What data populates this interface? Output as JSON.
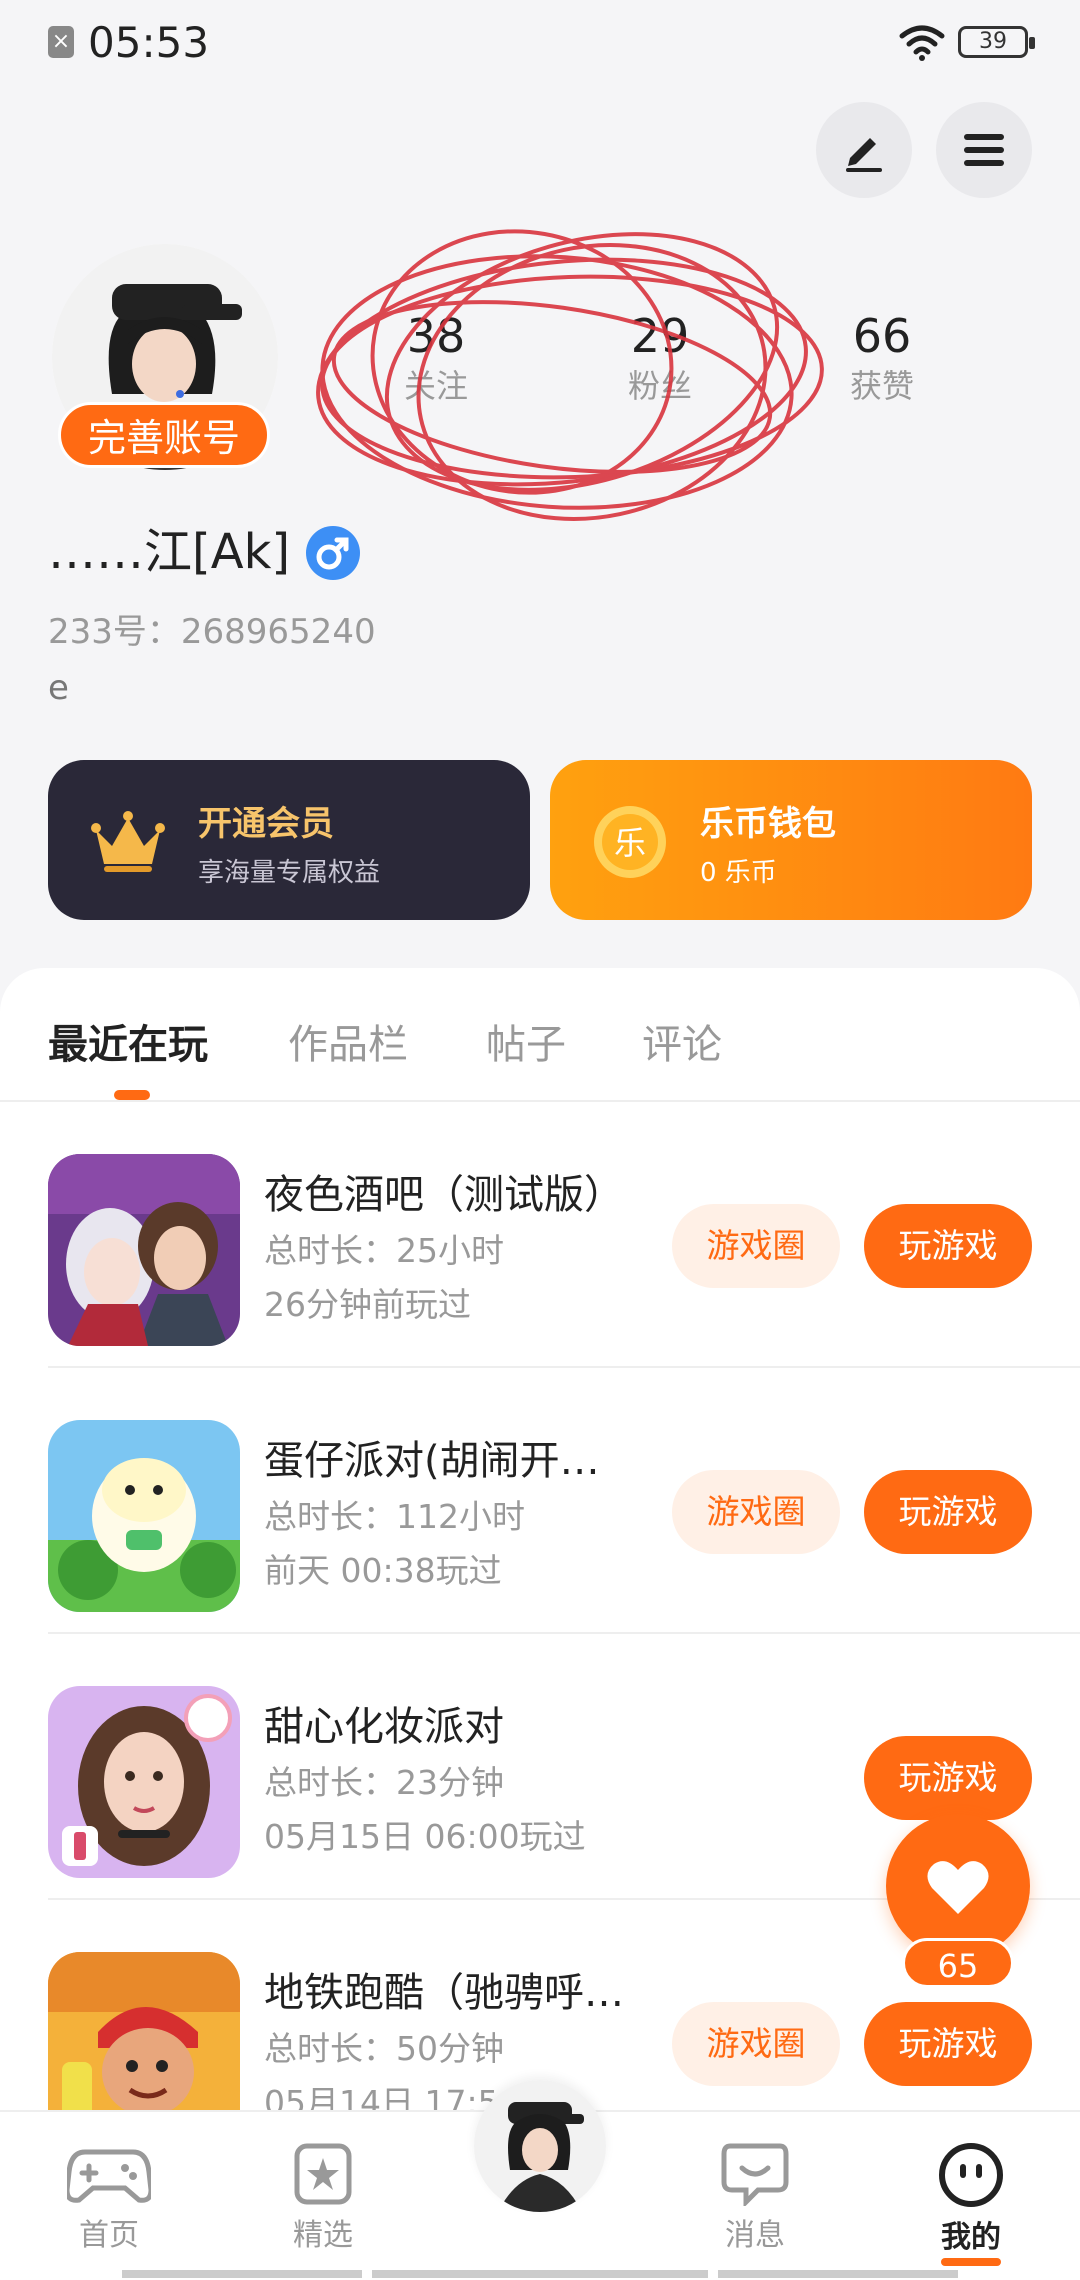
{
  "status_bar": {
    "time": "05:53",
    "battery": "39"
  },
  "profile": {
    "complete_label": "完善账号",
    "stats": [
      {
        "value": "38",
        "label": "关注"
      },
      {
        "value": "29",
        "label": "粉丝"
      },
      {
        "value": "66",
        "label": "获赞"
      }
    ],
    "nickname": "……江[Ak]",
    "uid": "233号：268965240",
    "bio": "e"
  },
  "cards": {
    "vip": {
      "title": "开通会员",
      "subtitle": "享海量专属权益"
    },
    "wallet": {
      "title": "乐币钱包",
      "subtitle": "0 乐币",
      "icon_char": "乐"
    }
  },
  "tabs": [
    "最近在玩",
    "作品栏",
    "帖子",
    "评论"
  ],
  "games": [
    {
      "name": "夜色酒吧（测试版）",
      "duration": "总时长：25小时",
      "last_played": "26分钟前玩过",
      "circle_label": "游戏圈",
      "play_label": "玩游戏"
    },
    {
      "name": "蛋仔派对(胡闹开…",
      "duration": "总时长：112小时",
      "last_played": "前天 00:38玩过",
      "circle_label": "游戏圈",
      "play_label": "玩游戏"
    },
    {
      "name": "甜心化妆派对",
      "duration": "总时长：23分钟",
      "last_played": "05月15日 06:00玩过",
      "circle_label": "",
      "play_label": "玩游戏"
    },
    {
      "name": "地铁跑酷（驰骋呼…",
      "duration": "总时长：50分钟",
      "last_played": "05月14日 17:5",
      "circle_label": "游戏圈",
      "play_label": "玩游戏"
    }
  ],
  "fab": {
    "count": "65"
  },
  "nav": [
    {
      "label": "首页",
      "icon": "gamepad-icon"
    },
    {
      "label": "精选",
      "icon": "star-bookmark-icon"
    },
    {
      "label": "消息",
      "icon": "chat-icon"
    },
    {
      "label": "我的",
      "icon": "face-icon"
    }
  ],
  "colors": {
    "accent": "#ff6a13",
    "vip_bg": "#2a2838",
    "vip_gold": "#f7c46b"
  }
}
